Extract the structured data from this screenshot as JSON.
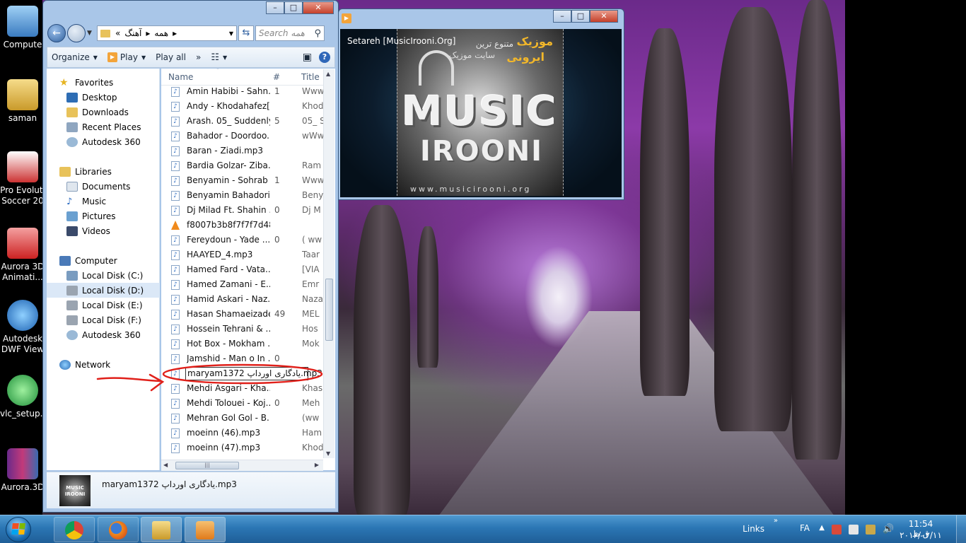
{
  "desktop": {
    "icons": [
      {
        "label": "Compute",
        "icon": "computer-icon"
      },
      {
        "label": "saman",
        "icon": "user-folder-icon"
      },
      {
        "label": "Pro Evoluti Soccer 20",
        "icon": "game-shortcut-icon"
      },
      {
        "label": "Aurora 3D Animati...",
        "icon": "aurora-shortcut-icon"
      },
      {
        "label": "Autodesk DWF View",
        "icon": "autodesk-shortcut-icon"
      },
      {
        "label": "vlc_setup.e",
        "icon": "setup-icon"
      },
      {
        "label": "Aurora.3D",
        "icon": "winrar-archive-icon"
      }
    ]
  },
  "explorer": {
    "address": {
      "crumbs": [
        "«",
        "آهنگ",
        "همه"
      ]
    },
    "search_placeholder": "Search همه",
    "toolbar": {
      "organize": "Organize",
      "play": "Play",
      "play_all": "Play all",
      "more": "»"
    },
    "nav": {
      "favorites": "Favorites",
      "desktop": "Desktop",
      "downloads": "Downloads",
      "recent": "Recent Places",
      "autodesk360": "Autodesk 360",
      "libraries": "Libraries",
      "documents": "Documents",
      "music": "Music",
      "pictures": "Pictures",
      "videos": "Videos",
      "computer": "Computer",
      "disk_c": "Local Disk (C:)",
      "disk_d": "Local Disk (D:)",
      "disk_e": "Local Disk (E:)",
      "disk_f": "Local Disk (F:)",
      "autodesk360b": "Autodesk 360",
      "network": "Network"
    },
    "columns": {
      "name": "Name",
      "num": "#",
      "title": "Title"
    },
    "files": [
      {
        "name": "Amin Habibi - Sahn...",
        "num": "1",
        "title": "Www"
      },
      {
        "name": "Andy - Khodahafez[...",
        "num": "",
        "title": "Khod"
      },
      {
        "name": "Arash. 05_ Suddenly...",
        "num": "5",
        "title": "05_ S"
      },
      {
        "name": "Bahador - Doordoo...",
        "num": "",
        "title": "wWw"
      },
      {
        "name": "Baran - Ziadi.mp3",
        "num": "",
        "title": ""
      },
      {
        "name": "Bardia Golzar- Ziba...",
        "num": "",
        "title": "Ram"
      },
      {
        "name": "Benyamin - Sohrab ...",
        "num": "1",
        "title": "Www"
      },
      {
        "name": "Benyamin Bahadori...",
        "num": "",
        "title": "Beny"
      },
      {
        "name": "Dj Milad Ft. Shahin ...",
        "num": "0",
        "title": "Dj M"
      },
      {
        "name": "f8007b3b8f7f7f7d48...",
        "num": "",
        "title": ""
      },
      {
        "name": "Fereydoun - Yade ...",
        "num": "0",
        "title": "( ww"
      },
      {
        "name": "HAAYED_4.mp3",
        "num": "",
        "title": "Taar"
      },
      {
        "name": "Hamed Fard - Vata...",
        "num": "",
        "title": "[VIA"
      },
      {
        "name": "Hamed Zamani - E...",
        "num": "",
        "title": "Emr"
      },
      {
        "name": "Hamid Askari - Naz...",
        "num": "",
        "title": "Naza"
      },
      {
        "name": "Hasan Shamaeizade...",
        "num": "49",
        "title": "MEL"
      },
      {
        "name": "Hossein Tehrani & ...",
        "num": "",
        "title": "Hos"
      },
      {
        "name": "Hot Box - Mokham ...",
        "num": "",
        "title": "Mok"
      },
      {
        "name": "Jamshid - Man o In ...",
        "num": "0",
        "title": ""
      },
      {
        "name": "maryam1372 یادگاری اورداپ.mp3",
        "num": "",
        "title": ""
      },
      {
        "name": "Mehdi Asgari - Kha...",
        "num": "",
        "title": "Khas"
      },
      {
        "name": "Mehdi Tolouei - Koj...",
        "num": "0",
        "title": "Meh"
      },
      {
        "name": "Mehran Gol Gol - B...",
        "num": "",
        "title": "(ww"
      },
      {
        "name": "moeinn (46).mp3",
        "num": "",
        "title": "Ham"
      },
      {
        "name": "moeinn (47).mp3",
        "num": "",
        "title": "Khod"
      }
    ],
    "details": {
      "filename": "maryam1372 یادگاری اورداپ.mp3",
      "thumb_text": "MUSIC IROONI"
    }
  },
  "player": {
    "title": "Setareh [MusicIrooni.Org]",
    "album_art": {
      "fa_line1": "موزیک",
      "fa_line2": "متنوع ترین",
      "fa_line3": "ایرونی",
      "fa_line4": "سایت موزیک",
      "brand1": "MUSIC",
      "brand2": "IROONI",
      "url": "www.musicirooni.org"
    }
  },
  "taskbar": {
    "apps": [
      "chrome-icon",
      "firefox-icon",
      "explorer-icon",
      "media-player-icon"
    ],
    "links": "Links",
    "links_chevron": "»",
    "lang": "FA",
    "tray_up": "▲",
    "time": "11:54 ق.ظ",
    "date": "۲۰۱۶/۰۲/۱۱"
  },
  "colors": {
    "annotation": "#e0201a",
    "taskbar": "#2b76b4",
    "selection": "#dbe8f7"
  }
}
